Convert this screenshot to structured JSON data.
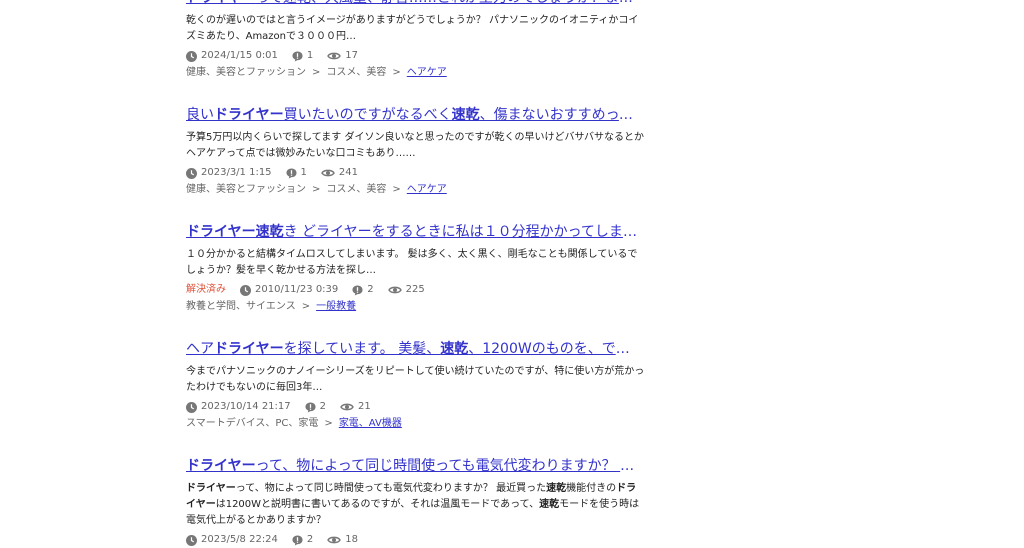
{
  "results": [
    {
      "title_parts": [
        {
          "t": "ドライヤー",
          "b": true
        },
        {
          "t": "って速乾、大風量、静音……どれが主力のでしょうか？また静音だと",
          "b": false
        }
      ],
      "snippet_parts": [
        {
          "t": "乾くのが遅いのではと言うイメージがありますがどうでしょうか？ パナソニックのイオニティかコイズミあたり、Amazonで３０００円…",
          "b": false
        }
      ],
      "resolved": "",
      "date": "2024/1/15 0:01",
      "answers": "1",
      "views": "17",
      "categories": [
        "健康、美容とファッション",
        "コスメ、美容"
      ],
      "category_link": "ヘアケア"
    },
    {
      "title_parts": [
        {
          "t": "良い",
          "b": false
        },
        {
          "t": "ドライヤー",
          "b": true
        },
        {
          "t": "買いたいのですがなるべく",
          "b": false
        },
        {
          "t": "速乾",
          "b": true
        },
        {
          "t": "、傷まないおすすめってあります…",
          "b": false
        }
      ],
      "snippet_parts": [
        {
          "t": "予算5万円以内くらいで探してます ダイソン良いなと思ったのですが乾くの早いけどバサバサなるとかヘアケアって点では微妙みたいな口コミもあり……",
          "b": false
        }
      ],
      "resolved": "",
      "date": "2023/3/1 1:15",
      "answers": "1",
      "views": "241",
      "categories": [
        "健康、美容とファッション",
        "コスメ、美容"
      ],
      "category_link": "ヘアケア"
    },
    {
      "title_parts": [
        {
          "t": "ドライヤー速乾",
          "b": true
        },
        {
          "t": "き どライヤーをするときに私は１０分程かかってしまうのですが…",
          "b": false
        }
      ],
      "snippet_parts": [
        {
          "t": "１０分かかると結構タイムロスしてしまいます。 髪は多く、太く黒く、剛毛なことも関係しているでしょうか？髪を早く乾かせる方法を探し…",
          "b": false
        }
      ],
      "resolved": "解決済み",
      "date": "2010/11/23 0:39",
      "answers": "2",
      "views": "225",
      "categories": [
        "教養と学問、サイエンス"
      ],
      "category_link": "一般教養"
    },
    {
      "title_parts": [
        {
          "t": "ヘア",
          "b": false
        },
        {
          "t": "ドライヤー",
          "b": true
        },
        {
          "t": "を探しています。 美髪、",
          "b": false
        },
        {
          "t": "速乾",
          "b": true
        },
        {
          "t": "、1200Wのものを、できれば2万以…",
          "b": false
        }
      ],
      "snippet_parts": [
        {
          "t": "今までパナソニックのナノイーシリーズをリピートして使い続けていたのですが、特に使い方が荒かったわけでもないのに毎回3年…",
          "b": false
        }
      ],
      "resolved": "",
      "date": "2023/10/14 21:17",
      "answers": "2",
      "views": "21",
      "categories": [
        "スマートデバイス、PC、家電"
      ],
      "category_link": "家電、AV機器"
    },
    {
      "title_parts": [
        {
          "t": "ドライヤー",
          "b": true
        },
        {
          "t": "って、物によって同じ時間使っても電気代変わりますか？ 最近買った…",
          "b": false
        }
      ],
      "snippet_parts": [
        {
          "t": "ドライヤー",
          "b": true
        },
        {
          "t": "って、物によって同じ時間使っても電気代変わりますか？ 最近買った",
          "b": false
        },
        {
          "t": "速乾",
          "b": true
        },
        {
          "t": "機能付きの",
          "b": false
        },
        {
          "t": "ドライヤー",
          "b": true
        },
        {
          "t": "は1200Wと説明書に書いてあるのですが、それは温風モードであって、",
          "b": false
        },
        {
          "t": "速乾",
          "b": true
        },
        {
          "t": "モードを使う時は電気代上がるとかありますか？",
          "b": false
        }
      ],
      "resolved": "",
      "date": "2023/5/8 22:24",
      "answers": "2",
      "views": "18",
      "categories": [],
      "category_link": ""
    }
  ]
}
